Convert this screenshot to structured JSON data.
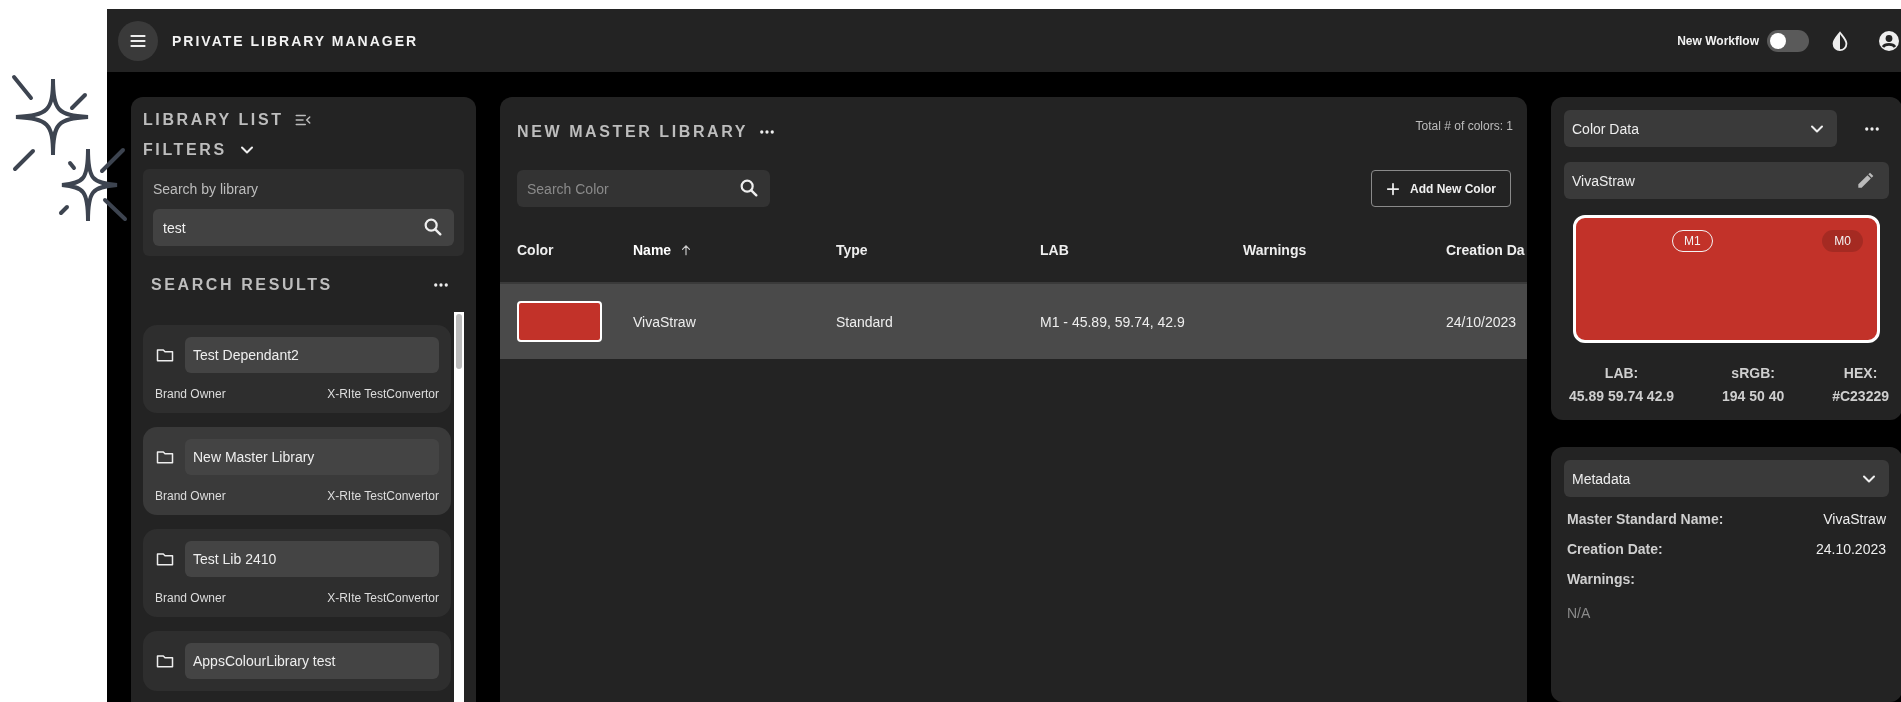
{
  "header": {
    "title": "PRIVATE LIBRARY MANAGER",
    "workflow_toggle": {
      "label": "New Workflow",
      "on": false
    }
  },
  "library_panel": {
    "title": "LIBRARY LIST",
    "filters_label": "FILTERS",
    "search": {
      "label": "Search by library",
      "value": "test"
    },
    "results_title": "SEARCH RESULTS",
    "results": [
      {
        "name": "Test Dependant2",
        "owner_label": "Brand Owner",
        "owner": "X-RIte TestConvertor",
        "selected": false
      },
      {
        "name": "New Master Library",
        "owner_label": "Brand Owner",
        "owner": "X-RIte TestConvertor",
        "selected": true
      },
      {
        "name": "Test Lib 2410",
        "owner_label": "Brand Owner",
        "owner": "X-RIte TestConvertor",
        "selected": false
      },
      {
        "name": "AppsColourLibrary test",
        "selected": false
      }
    ]
  },
  "library": {
    "title": "NEW MASTER LIBRARY",
    "total": "Total # of colors: 1",
    "search": {
      "placeholder": "Search Color"
    },
    "add_button": "Add New Color",
    "columns": [
      {
        "label": "Color",
        "sorted": false
      },
      {
        "label": "Name",
        "sorted": true
      },
      {
        "label": "Type",
        "sorted": false
      },
      {
        "label": "LAB",
        "sorted": false
      },
      {
        "label": "Warnings",
        "sorted": false
      },
      {
        "label": "Creation Da",
        "sorted": false
      }
    ],
    "rows": [
      {
        "color": "#c23229",
        "name": "VivaStraw",
        "type": "Standard",
        "lab": "M1 - 45.89, 59.74, 42.9",
        "date": "24/10/2023",
        "selected": true
      }
    ]
  },
  "color_data": {
    "select": "Color Data",
    "name": "VivaStraw",
    "color": "#c23229",
    "measurements": [
      {
        "label": "M1",
        "selected": true
      },
      {
        "label": "M0",
        "selected": false
      }
    ],
    "values": [
      {
        "label": "LAB:",
        "value": "45.89 59.74 42.9"
      },
      {
        "label": "sRGB:",
        "value": "194 50 40"
      },
      {
        "label": "HEX:",
        "value": "#C23229"
      }
    ]
  },
  "metadata": {
    "select": "Metadata",
    "fields": [
      {
        "kind": "inline",
        "label": "Master Standard Name:",
        "value": "VivaStraw"
      },
      {
        "kind": "inline",
        "label": "Creation Date:",
        "value": "24.10.2023"
      },
      {
        "kind": "stacked",
        "label": "Warnings:",
        "value": "N/A"
      }
    ]
  }
}
